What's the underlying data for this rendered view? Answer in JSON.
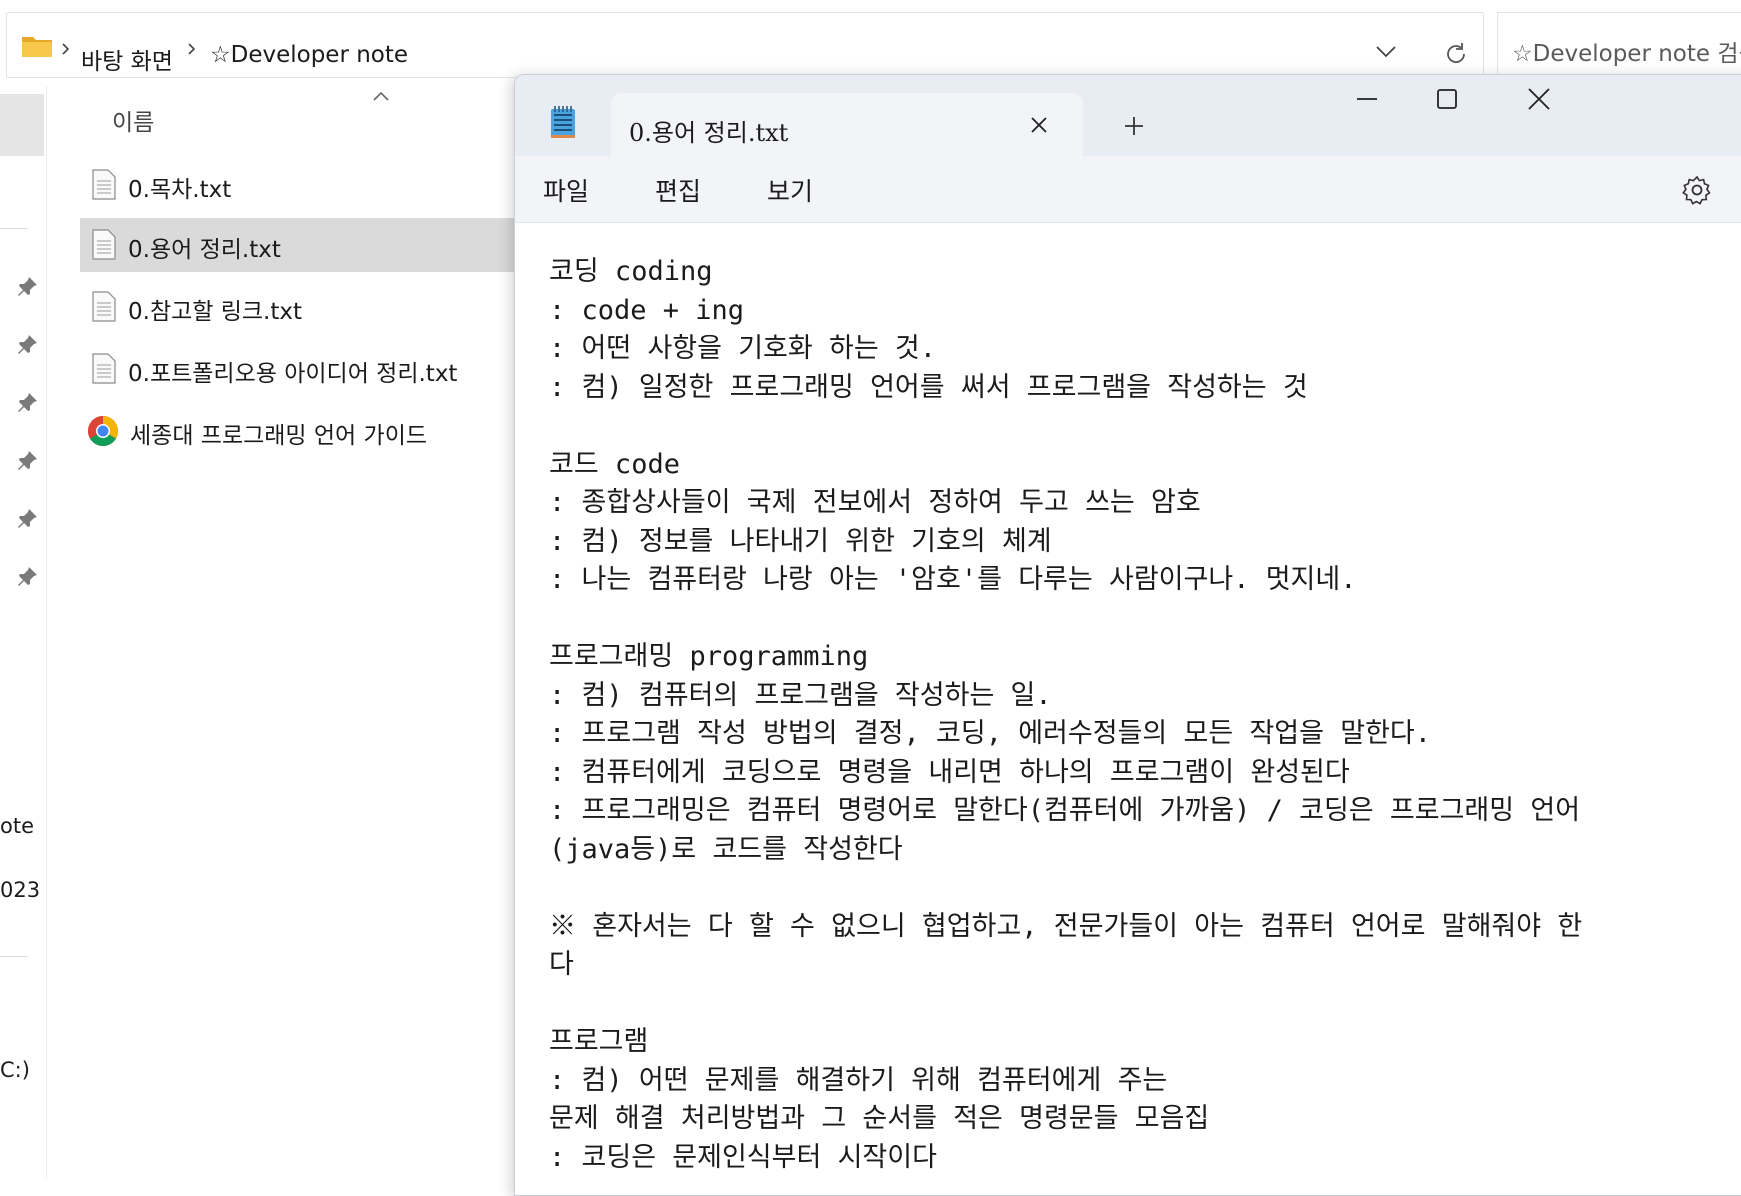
{
  "explorer": {
    "breadcrumb": [
      "바탕 화면",
      "☆Developer note"
    ],
    "search_placeholder": "☆Developer note 검색",
    "nav_partial": [
      "ote",
      "023",
      "C:)"
    ],
    "column_header": "이름",
    "files": [
      {
        "name": "0.목차.txt",
        "icon": "text-file-icon",
        "selected": false
      },
      {
        "name": "0.용어 정리.txt",
        "icon": "text-file-icon",
        "selected": true
      },
      {
        "name": "0.참고할 링크.txt",
        "icon": "text-file-icon",
        "selected": false
      },
      {
        "name": "0.포트폴리오용 아이디어 정리.txt",
        "icon": "text-file-icon",
        "selected": false
      },
      {
        "name": "세종대 프로그래밍 언어 가이드",
        "icon": "chrome-icon",
        "selected": false
      }
    ]
  },
  "notepad": {
    "tab_title": "0.용어 정리.txt",
    "menu": [
      "파일",
      "편집",
      "보기"
    ],
    "lines": [
      "코딩 coding",
      ": code + ing",
      ": 어떤 사항을 기호화 하는 것.",
      ": 컴) 일정한 프로그래밍 언어를 써서 프로그램을 작성하는 것",
      "",
      "코드 code",
      ": 종합상사들이 국제 전보에서 정하여 두고 쓰는 암호",
      ": 컴) 정보를 나타내기 위한 기호의 체계",
      ": 나는 컴퓨터랑 나랑 아는 '암호'를 다루는 사람이구나. 멋지네.",
      "",
      "프로그래밍 programming",
      ": 컴) 컴퓨터의 프로그램을 작성하는 일.",
      ": 프로그램 작성 방법의 결정, 코딩, 에러수정들의 모든 작업을 말한다.",
      ": 컴퓨터에게 코딩으로 명령을 내리면 하나의 프로그램이 완성된다",
      ": 프로그래밍은 컴퓨터 명령어로 말한다(컴퓨터에 가까움) / 코딩은 프로그래밍 언어",
      "(java등)로 코드를 작성한다",
      "",
      "※ 혼자서는 다 할 수 없으니 협업하고, 전문가들이 아는 컴퓨터 언어로 말해줘야 한",
      "다",
      "",
      "프로그램",
      ": 컴) 어떤 문제를 해결하기 위해 컴퓨터에게 주는",
      "문제 해결 처리방법과 그 순서를 적은 명령문들 모음집",
      ": 코딩은 문제인식부터 시작이다"
    ]
  },
  "colors": {
    "selected_row": "#dadada",
    "notepad_chrome": "#e8ecf3",
    "menubar": "#f3f4f7",
    "folder": "#f6c33f"
  }
}
